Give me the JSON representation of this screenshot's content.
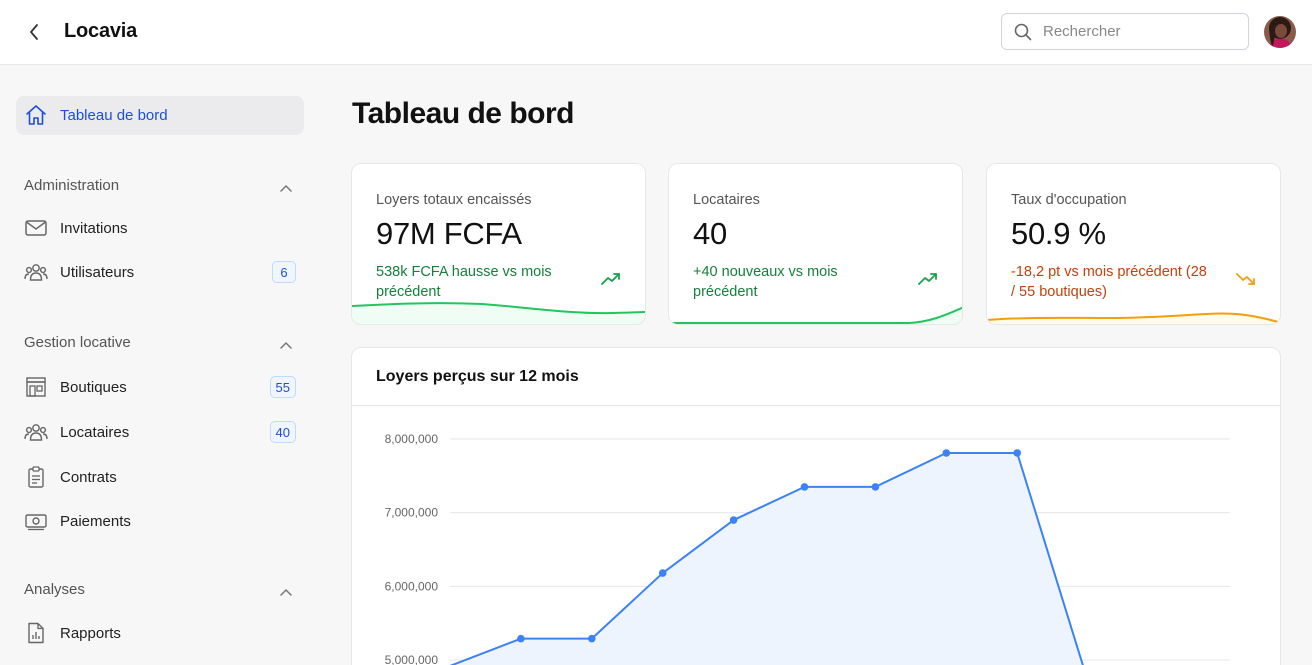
{
  "header": {
    "app_title": "Locavia",
    "search_placeholder": "Rechercher"
  },
  "sidebar": {
    "active": {
      "label": "Tableau de bord"
    },
    "sections": [
      {
        "title": "Administration",
        "items": [
          {
            "label": "Invitations",
            "icon": "mail-icon"
          },
          {
            "label": "Utilisateurs",
            "icon": "users-icon",
            "badge": "6"
          }
        ]
      },
      {
        "title": "Gestion locative",
        "items": [
          {
            "label": "Boutiques",
            "icon": "store-icon",
            "badge": "55"
          },
          {
            "label": "Locataires",
            "icon": "users-icon",
            "badge": "40"
          },
          {
            "label": "Contrats",
            "icon": "clipboard-icon"
          },
          {
            "label": "Paiements",
            "icon": "banknote-icon"
          }
        ]
      },
      {
        "title": "Analyses",
        "items": [
          {
            "label": "Rapports",
            "icon": "report-icon"
          }
        ]
      }
    ]
  },
  "main": {
    "title": "Tableau de bord",
    "cards": [
      {
        "label": "Loyers totaux encaissés",
        "value": "97M FCFA",
        "delta": "538k FCFA hausse vs mois précédent",
        "trend": "up",
        "color": "#16a34a"
      },
      {
        "label": "Locataires",
        "value": "40",
        "delta": "+40 nouveaux vs mois précédent",
        "trend": "up",
        "color": "#16a34a"
      },
      {
        "label": "Taux d'occupation",
        "value": "50.9 %",
        "delta": "-18,2 pt vs mois précédent (28 / 55 boutiques)",
        "trend": "down",
        "color": "#f59e0b"
      }
    ]
  },
  "chart_data": {
    "type": "area",
    "title": "Loyers perçus sur 12 mois",
    "xlabel": "",
    "ylabel": "",
    "ylim": [
      5000000,
      8000000
    ],
    "yticks": [
      "5,000,000",
      "6,000,000",
      "7,000,000",
      "8,000,000"
    ],
    "ytick_values": [
      5000000,
      6000000,
      7000000,
      8000000
    ],
    "series": [
      {
        "values": [
          4920000,
          5290000,
          5290000,
          6180000,
          6900000,
          7350000,
          7350000,
          7810000,
          7810000,
          4700000
        ],
        "color": "#3b82f6",
        "fill": "#eef4fe"
      }
    ],
    "grid": true
  }
}
